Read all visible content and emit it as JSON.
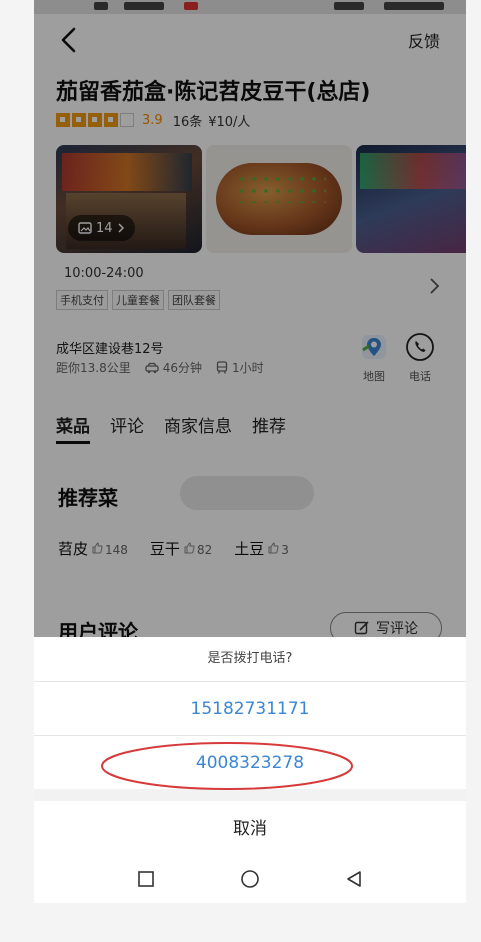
{
  "header": {
    "feedback": "反馈"
  },
  "shop": {
    "title": "茄留香茄盒·陈记苕皮豆干(总店)",
    "score": "3.9",
    "reviews": "16条",
    "price": "¥10/人",
    "photo_count": "14",
    "hours": "10:00-24:00",
    "tags": [
      "手机支付",
      "儿童套餐",
      "团队套餐"
    ],
    "address": "成华区建设巷12号",
    "distance": "距你13.8公里",
    "drive": "46分钟",
    "bus": "1小时",
    "map_label": "地图",
    "phone_label": "电话"
  },
  "tabs": [
    "菜品",
    "评论",
    "商家信息",
    "推荐"
  ],
  "recommend": {
    "title": "推荐菜",
    "items": [
      {
        "name": "苕皮",
        "count": "148"
      },
      {
        "name": "豆干",
        "count": "82"
      },
      {
        "name": "土豆",
        "count": "3"
      }
    ]
  },
  "reviews_section": {
    "title": "用户评论",
    "write": "写评论"
  },
  "dialog": {
    "title": "是否拨打电话?",
    "phone1": "15182731171",
    "phone2": "4008323278",
    "cancel": "取消"
  },
  "colors": {
    "accent": "#3b86d4",
    "rating": "#f39c12",
    "annotation": "#d63a3a"
  }
}
